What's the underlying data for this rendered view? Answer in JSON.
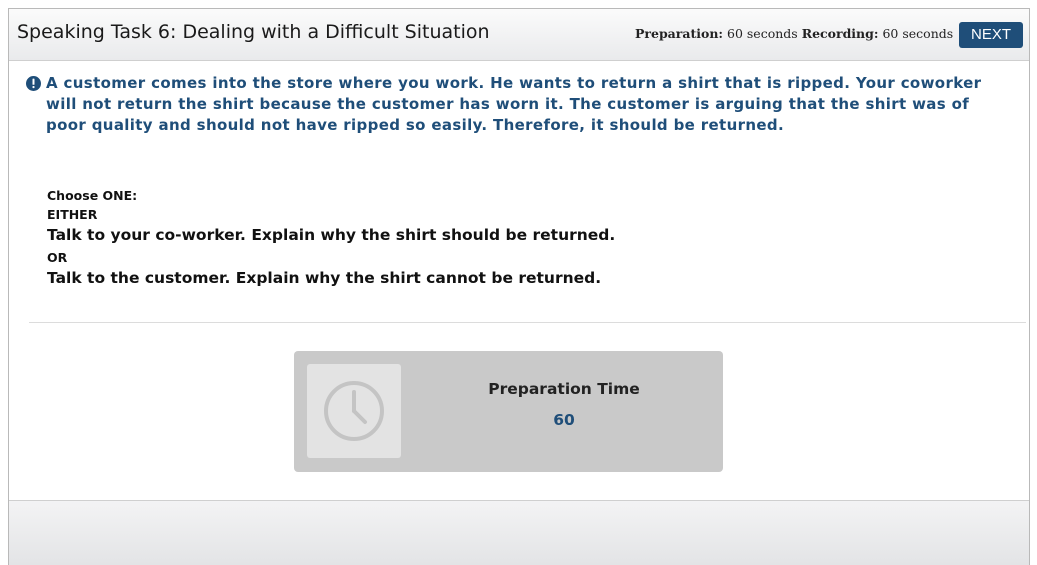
{
  "header": {
    "title": "Speaking Task 6: Dealing with a Difficult Situation",
    "preparation_label": "Preparation:",
    "preparation_value": "60 seconds",
    "recording_label": "Recording:",
    "recording_value": "60 seconds",
    "next_label": "NEXT"
  },
  "prompt": {
    "scenario": "A customer comes into the store where you work. He wants to return a shirt that is ripped. Your coworker will not return the shirt because the customer has worn it. The customer is arguing that the shirt was of poor quality and should not have ripped so easily. Therefore, it should be returned.",
    "choose_label": "Choose ONE:",
    "either_label": "EITHER",
    "option_1": "Talk to your co-worker.  Explain why the shirt should be returned.",
    "or_label": "OR",
    "option_2": "Talk to the customer.  Explain why the shirt cannot be returned."
  },
  "timer": {
    "label": "Preparation Time",
    "value": "60",
    "icon": "clock-icon"
  },
  "colors": {
    "accent": "#1f4e79",
    "timer_box": "#c9c9c9",
    "clock_tile": "#e3e3e3"
  }
}
